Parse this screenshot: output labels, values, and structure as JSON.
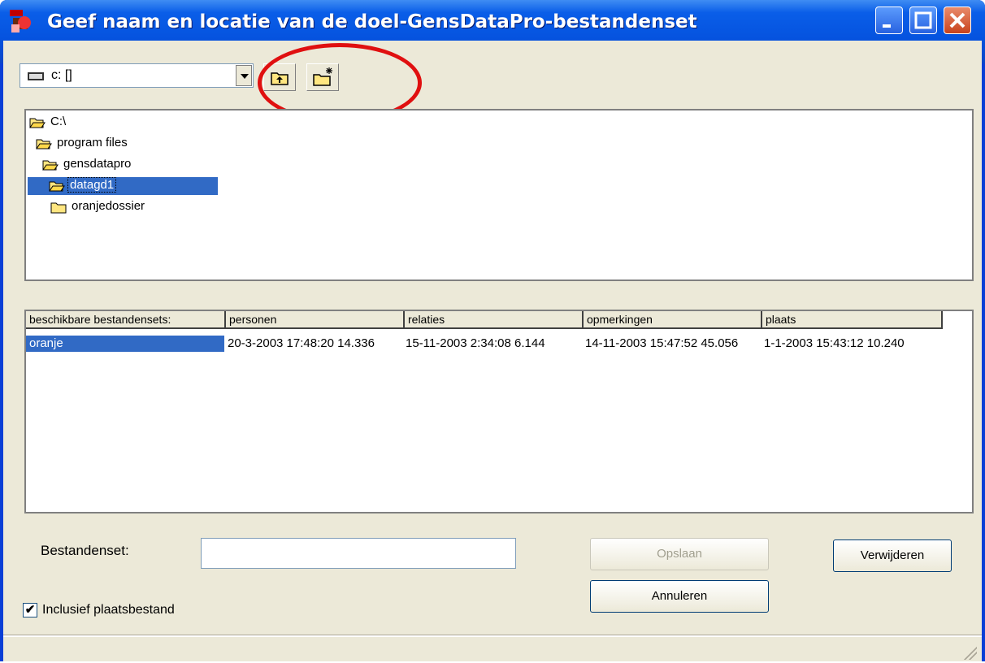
{
  "window": {
    "title": "Geef naam en locatie van de doel-GensDataPro-bestandenset",
    "app_icon": "gensdatapro-app-icon",
    "controls": [
      "minimize-icon",
      "maximize-icon",
      "close-icon"
    ]
  },
  "toolbar": {
    "drive_value": "c: []",
    "up_folder_icon": "up-folder-icon",
    "new_folder_icon": "new-folder-icon"
  },
  "folders": [
    {
      "label": "C:\\"
    },
    {
      "label": "program files"
    },
    {
      "label": "gensdatapro"
    },
    {
      "label": "datagd1",
      "selected": true
    },
    {
      "label": "oranjedossier"
    }
  ],
  "table": {
    "columns": [
      "beschikbare bestandensets:",
      "personen",
      "relaties",
      "opmerkingen",
      "plaats"
    ],
    "rows": [
      [
        "oranje",
        "20-3-2003 17:48:20 14.336",
        "15-11-2003 2:34:08 6.144",
        "14-11-2003 15:47:52 45.056",
        "1-1-2003 15:43:12 10.240"
      ]
    ]
  },
  "form": {
    "bestandenset_label": "Bestandenset:",
    "bestandenset_value": "",
    "save_label": "Opslaan",
    "cancel_label": "Annuleren",
    "delete_label": "Verwijderen",
    "include_label": "Inclusief plaatsbestand",
    "include_checked": true,
    "check_mark": "✔"
  },
  "colors": {
    "titlebar": "#0553df",
    "selection": "#316ac5",
    "annotation_circle": "#e01010"
  }
}
